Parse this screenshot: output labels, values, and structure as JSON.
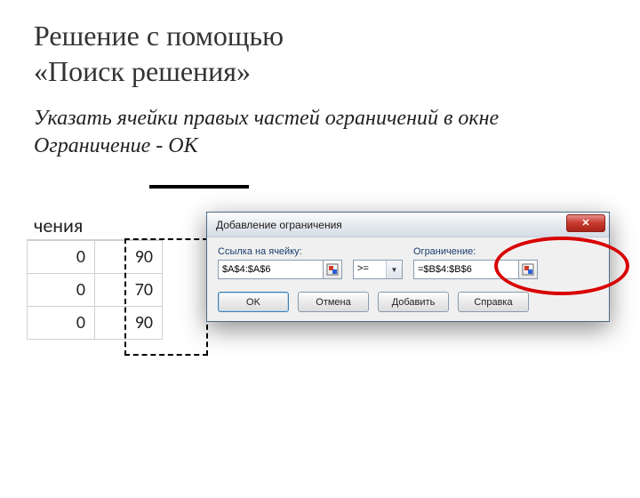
{
  "title_line1": "Решение с помощью",
  "title_line2": "«Поиск решения»",
  "instruction": "Указать ячейки правых частей ограничений в окне Ограничение - ОК",
  "sheet": {
    "header_fragment": "чения",
    "rows": [
      {
        "a": "0",
        "b": "90"
      },
      {
        "a": "0",
        "b": "70"
      },
      {
        "a": "0",
        "b": "90"
      }
    ]
  },
  "dialog": {
    "title": "Добавление ограничения",
    "cell_ref_label": "Ссылка на ячейку:",
    "cell_ref_value": "$A$4:$A$6",
    "operator": ">=",
    "constraint_label": "Ограничение:",
    "constraint_value": "=$B$4:$B$6",
    "btn_ok": "OK",
    "btn_cancel": "Отмена",
    "btn_add": "Добавить",
    "btn_help": "Справка"
  }
}
